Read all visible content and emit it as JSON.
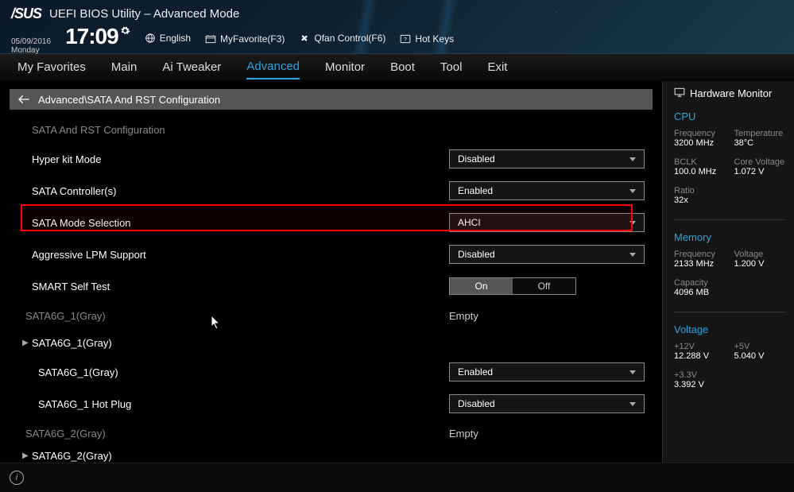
{
  "header": {
    "brand": "/SUS",
    "title": "UEFI BIOS Utility – Advanced Mode",
    "date": "05/09/2016",
    "day": "Monday",
    "time": "17:09",
    "toolbar": {
      "language": "English",
      "favorite": "MyFavorite(F3)",
      "qfan": "Qfan Control(F6)",
      "hotkeys": "Hot Keys"
    }
  },
  "tabs": [
    "My Favorites",
    "Main",
    "Ai Tweaker",
    "Advanced",
    "Monitor",
    "Boot",
    "Tool",
    "Exit"
  ],
  "active_tab": "Advanced",
  "breadcrumb": "Advanced\\SATA And RST Configuration",
  "settings": {
    "heading": "SATA And RST Configuration",
    "hyperkit": {
      "label": "Hyper kit Mode",
      "value": "Disabled"
    },
    "controller": {
      "label": "SATA Controller(s)",
      "value": "Enabled"
    },
    "mode": {
      "label": "SATA Mode Selection",
      "value": "AHCI"
    },
    "lpm": {
      "label": "Aggressive LPM Support",
      "value": "Disabled"
    },
    "smart": {
      "label": "SMART Self Test",
      "on": "On",
      "off": "Off"
    },
    "port1a": {
      "label": "SATA6G_1(Gray)",
      "value": "Empty"
    },
    "port1b": {
      "label": "SATA6G_1(Gray)"
    },
    "port1c": {
      "label": "SATA6G_1(Gray)",
      "value": "Enabled"
    },
    "port1hp": {
      "label": "SATA6G_1 Hot Plug",
      "value": "Disabled"
    },
    "port2a": {
      "label": "SATA6G_2(Gray)",
      "value": "Empty"
    },
    "port2b": {
      "label": "SATA6G_2(Gray)"
    }
  },
  "sidebar": {
    "title": "Hardware Monitor",
    "cpu": {
      "title": "CPU",
      "freq_label": "Frequency",
      "freq": "3200 MHz",
      "temp_label": "Temperature",
      "temp": "38°C",
      "bclk_label": "BCLK",
      "bclk": "100.0 MHz",
      "cv_label": "Core Voltage",
      "cv": "1.072 V",
      "ratio_label": "Ratio",
      "ratio": "32x"
    },
    "memory": {
      "title": "Memory",
      "freq_label": "Frequency",
      "freq": "2133 MHz",
      "volt_label": "Voltage",
      "volt": "1.200 V",
      "cap_label": "Capacity",
      "cap": "4096 MB"
    },
    "voltage": {
      "title": "Voltage",
      "v12_label": "+12V",
      "v12": "12.288 V",
      "v5_label": "+5V",
      "v5": "5.040 V",
      "v33_label": "+3.3V",
      "v33": "3.392 V"
    }
  }
}
